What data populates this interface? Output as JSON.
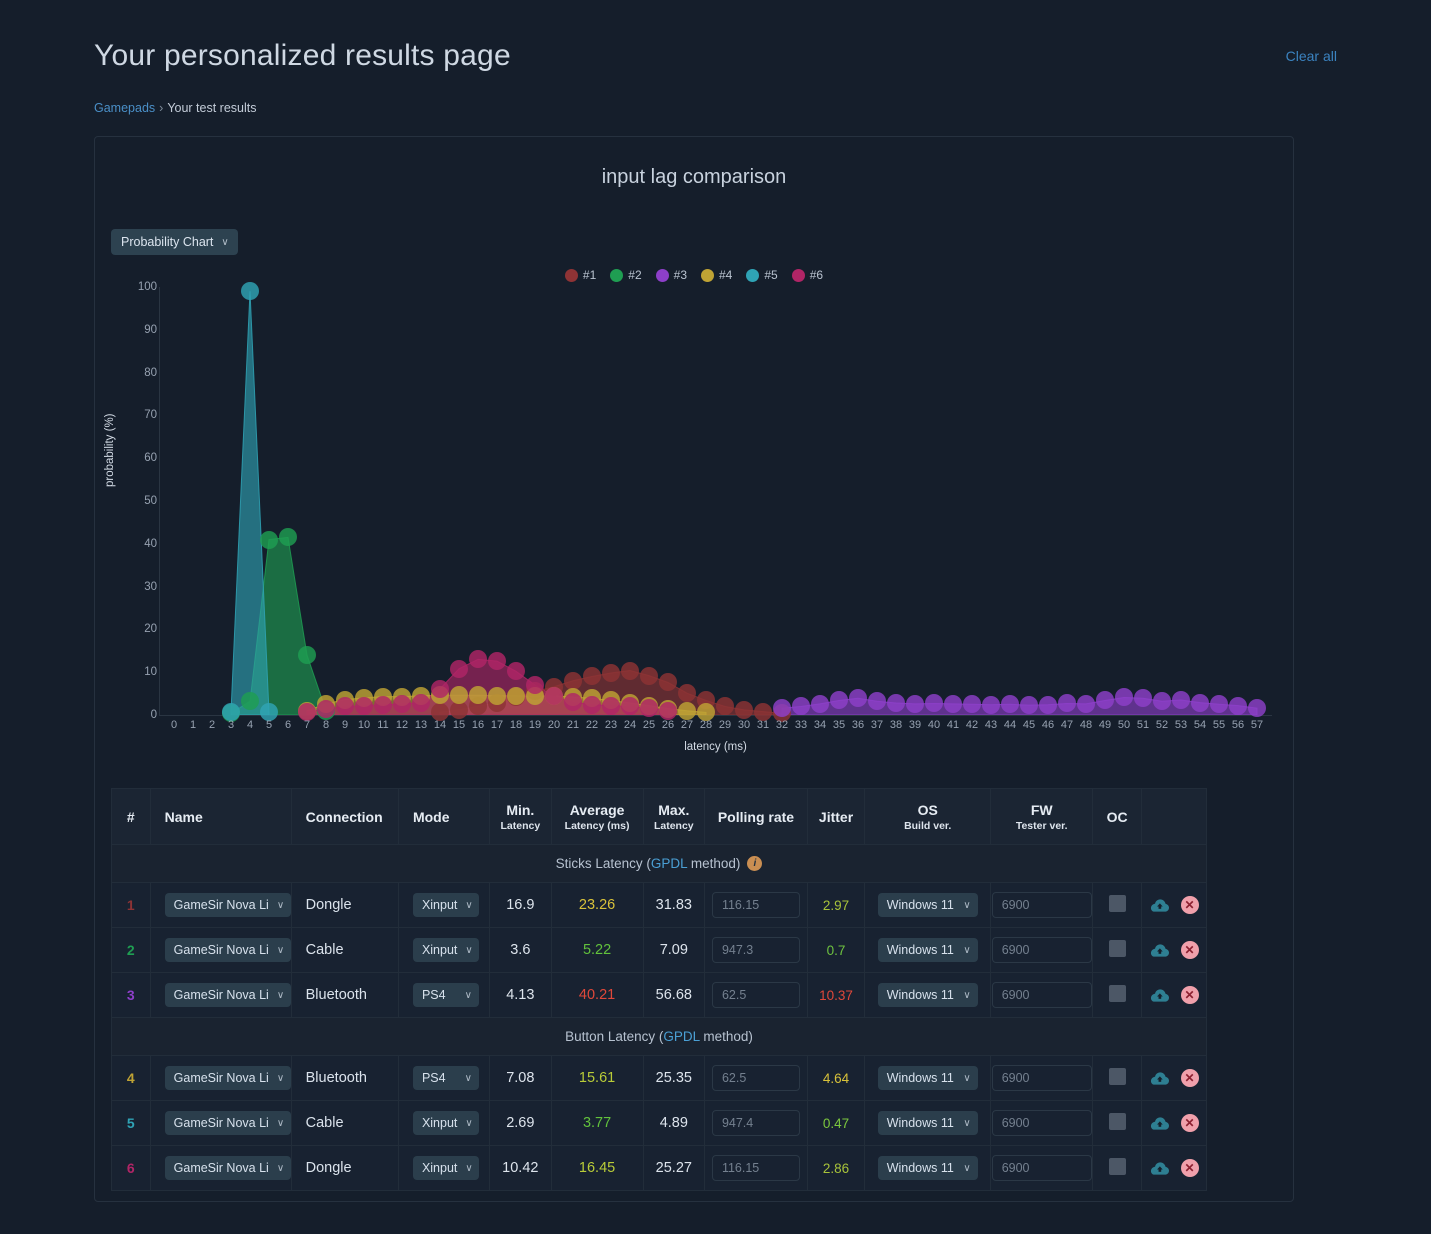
{
  "header": {
    "title": "Your personalized results page",
    "clear_all": "Clear all",
    "breadcrumb": {
      "root": "Gamepads",
      "separator": "›",
      "current": "Your test results"
    }
  },
  "chart_panel": {
    "title": "input lag comparison",
    "chart_type_selector": {
      "label": "Probability Chart",
      "chevron": "∨"
    }
  },
  "chart_data": {
    "type": "line",
    "title": "input lag comparison",
    "xlabel": "latency (ms)",
    "ylabel": "probability (%)",
    "xlim": [
      0,
      57
    ],
    "ylim": [
      0,
      100
    ],
    "yticks": [
      0,
      10,
      20,
      30,
      40,
      50,
      60,
      70,
      80,
      90,
      100
    ],
    "xticks": [
      0,
      1,
      2,
      3,
      4,
      5,
      6,
      7,
      8,
      9,
      10,
      11,
      12,
      13,
      14,
      15,
      16,
      17,
      18,
      19,
      20,
      21,
      22,
      23,
      24,
      25,
      26,
      27,
      28,
      29,
      30,
      31,
      32,
      33,
      34,
      35,
      36,
      37,
      38,
      39,
      40,
      41,
      42,
      43,
      44,
      45,
      46,
      47,
      48,
      49,
      50,
      51,
      52,
      53,
      54,
      55,
      56,
      57
    ],
    "grid": false,
    "legend_position": "top-center",
    "colors": {
      "#1": "#8e3335",
      "#2": "#1f9e52",
      "#3": "#8d3fc9",
      "#4": "#bfa334",
      "#5": "#2fa3b5",
      "#6": "#b02566"
    },
    "series": [
      {
        "name": "#1",
        "color": "#8e3335",
        "x": [
          14,
          15,
          16,
          17,
          18,
          19,
          20,
          21,
          22,
          23,
          24,
          25,
          26,
          27,
          28,
          29,
          30,
          31,
          32
        ],
        "values": [
          0.6,
          1.2,
          2.0,
          2.9,
          4.1,
          5.5,
          6.6,
          8.0,
          9.0,
          9.8,
          10.4,
          9.2,
          7.6,
          5.1,
          3.4,
          2.0,
          1.2,
          0.8,
          0.4
        ]
      },
      {
        "name": "#2",
        "color": "#1f9e52",
        "x": [
          3,
          4,
          5,
          6,
          7,
          8
        ],
        "values": [
          0.4,
          3.2,
          41.0,
          41.5,
          14.0,
          1.0
        ]
      },
      {
        "name": "#3",
        "color": "#8d3fc9",
        "x": [
          32,
          33,
          34,
          35,
          36,
          37,
          38,
          39,
          40,
          41,
          42,
          43,
          44,
          45,
          46,
          47,
          48,
          49,
          50,
          51,
          52,
          53,
          54,
          55,
          56,
          57
        ],
        "values": [
          1.6,
          2.0,
          2.6,
          3.4,
          3.9,
          3.2,
          2.8,
          2.6,
          2.7,
          2.6,
          2.5,
          2.4,
          2.5,
          2.3,
          2.4,
          2.7,
          2.6,
          3.4,
          4.1,
          3.9,
          3.2,
          3.5,
          2.9,
          2.5,
          2.2,
          1.6
        ]
      },
      {
        "name": "#4",
        "color": "#bfa334",
        "x": [
          7,
          8,
          9,
          10,
          11,
          12,
          13,
          14,
          15,
          16,
          17,
          18,
          19,
          20,
          21,
          22,
          23,
          24,
          25,
          26,
          27,
          28
        ],
        "values": [
          1.0,
          2.6,
          3.6,
          4.0,
          4.3,
          4.3,
          4.5,
          4.6,
          4.6,
          4.6,
          4.5,
          4.5,
          4.4,
          4.5,
          4.2,
          3.9,
          3.4,
          2.8,
          2.2,
          1.5,
          1.0,
          0.6
        ]
      },
      {
        "name": "#5",
        "color": "#2fa3b5",
        "x": [
          3,
          4,
          5
        ],
        "values": [
          0.8,
          99.0,
          0.6
        ]
      },
      {
        "name": "#6",
        "color": "#b02566",
        "x": [
          7,
          8,
          9,
          10,
          11,
          12,
          13,
          14,
          15,
          16,
          17,
          18,
          19,
          20,
          21,
          22,
          23,
          24,
          25,
          26
        ],
        "values": [
          0.8,
          1.4,
          2.0,
          2.2,
          2.4,
          2.6,
          2.9,
          6.1,
          10.8,
          13.0,
          12.6,
          10.2,
          7.0,
          4.4,
          3.0,
          2.4,
          2.2,
          2.0,
          1.6,
          1.0
        ]
      }
    ]
  },
  "table": {
    "columns": [
      {
        "key": "idx",
        "label": "#",
        "sub": ""
      },
      {
        "key": "name",
        "label": "Name",
        "sub": ""
      },
      {
        "key": "connection",
        "label": "Connection",
        "sub": ""
      },
      {
        "key": "mode",
        "label": "Mode",
        "sub": ""
      },
      {
        "key": "min",
        "label": "Min.",
        "sub": "Latency"
      },
      {
        "key": "avg",
        "label": "Average",
        "sub": "Latency (ms)"
      },
      {
        "key": "max",
        "label": "Max.",
        "sub": "Latency"
      },
      {
        "key": "polling",
        "label": "Polling rate",
        "sub": ""
      },
      {
        "key": "jitter",
        "label": "Jitter",
        "sub": ""
      },
      {
        "key": "os",
        "label": "OS",
        "sub": "Build ver."
      },
      {
        "key": "fw",
        "label": "FW",
        "sub": "Tester ver."
      },
      {
        "key": "oc",
        "label": "OC",
        "sub": ""
      },
      {
        "key": "actions",
        "label": "",
        "sub": ""
      }
    ],
    "sections": [
      {
        "label_prefix": "Sticks Latency (",
        "label_link": "GPDL",
        "label_suffix": " method)",
        "has_info_icon": true,
        "info_icon_glyph": "i",
        "rows": [
          {
            "idx": "1",
            "idx_color": "#8e3335",
            "name": "GameSir Nova Li",
            "connection": "Dongle",
            "mode": "Xinput",
            "min": "16.9",
            "avg": "23.26",
            "avg_color": "#d8c23a",
            "max": "31.83",
            "polling": "116.15",
            "jitter": "2.97",
            "jitter_color": "#a8c33a",
            "os": "Windows 11",
            "fw": "6900"
          },
          {
            "idx": "2",
            "idx_color": "#1f9e52",
            "name": "GameSir Nova Li",
            "connection": "Cable",
            "mode": "Xinput",
            "min": "3.6",
            "avg": "5.22",
            "avg_color": "#62c23c",
            "max": "7.09",
            "polling": "947.3",
            "jitter": "0.7",
            "jitter_color": "#6ec240",
            "os": "Windows 11",
            "fw": "6900"
          },
          {
            "idx": "3",
            "idx_color": "#8d3fc9",
            "name": "GameSir Nova Li",
            "connection": "Bluetooth",
            "mode": "PS4",
            "min": "4.13",
            "avg": "40.21",
            "avg_color": "#e0483a",
            "max": "56.68",
            "polling": "62.5",
            "jitter": "10.37",
            "jitter_color": "#e0483a",
            "os": "Windows 11",
            "fw": "6900"
          }
        ]
      },
      {
        "label_prefix": "Button Latency (",
        "label_link": "GPDL",
        "label_suffix": " method)",
        "has_info_icon": false,
        "info_icon_glyph": "",
        "rows": [
          {
            "idx": "4",
            "idx_color": "#bfa334",
            "name": "GameSir Nova Li",
            "connection": "Bluetooth",
            "mode": "PS4",
            "min": "7.08",
            "avg": "15.61",
            "avg_color": "#b9cc38",
            "max": "25.35",
            "polling": "62.5",
            "jitter": "4.64",
            "jitter_color": "#d8c23a",
            "os": "Windows 11",
            "fw": "6900"
          },
          {
            "idx": "5",
            "idx_color": "#2fa3b5",
            "name": "GameSir Nova Li",
            "connection": "Cable",
            "mode": "Xinput",
            "min": "2.69",
            "avg": "3.77",
            "avg_color": "#62c23c",
            "max": "4.89",
            "polling": "947.4",
            "jitter": "0.47",
            "jitter_color": "#7cc83e",
            "os": "Windows 11",
            "fw": "6900"
          },
          {
            "idx": "6",
            "idx_color": "#b02566",
            "name": "GameSir Nova Li",
            "connection": "Dongle",
            "mode": "Xinput",
            "min": "10.42",
            "avg": "16.45",
            "avg_color": "#b9cc38",
            "max": "25.27",
            "polling": "116.15",
            "jitter": "2.86",
            "jitter_color": "#a8c33a",
            "os": "Windows 11",
            "fw": "6900"
          }
        ]
      }
    ],
    "row_icons": {
      "upload": "cloud-upload-icon",
      "delete": "✕"
    }
  }
}
